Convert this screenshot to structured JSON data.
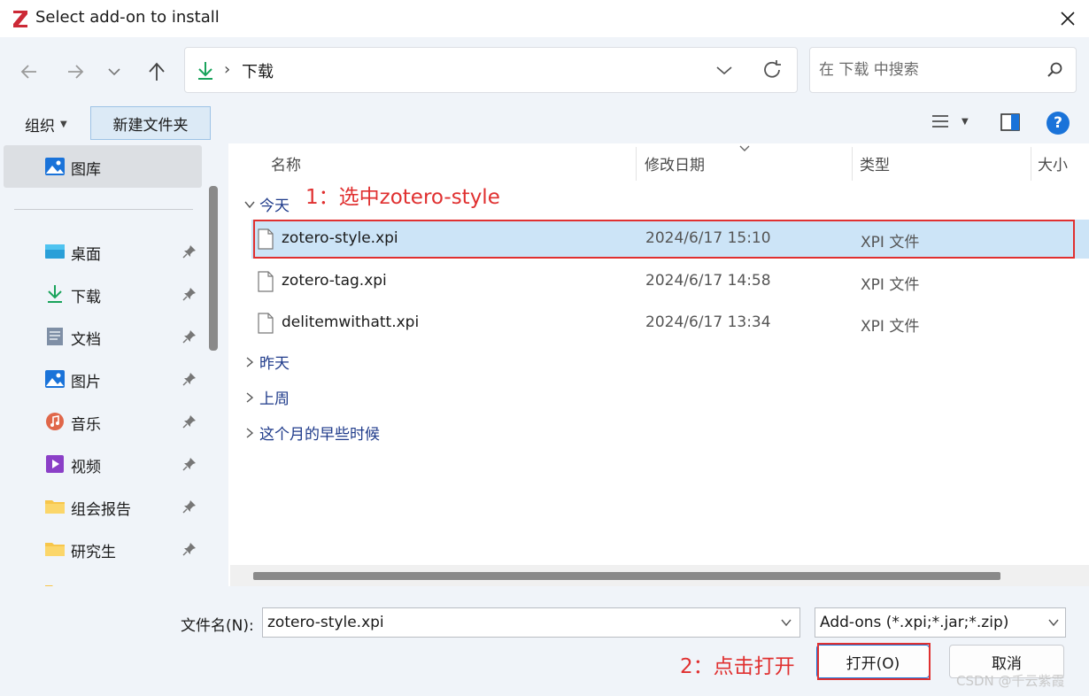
{
  "window": {
    "title": "Select add-on to install",
    "logo_letter": "Z"
  },
  "navigation": {
    "path": [
      "下载"
    ],
    "search_placeholder": "在 下载 中搜索"
  },
  "toolbar": {
    "organize_label": "组织",
    "new_folder_label": "新建文件夹",
    "help_label": "?"
  },
  "sidebar": {
    "items": [
      {
        "label": "图库",
        "icon": "gallery-icon"
      },
      {
        "label": "桌面",
        "icon": "desktop-icon"
      },
      {
        "label": "下载",
        "icon": "download-icon"
      },
      {
        "label": "文档",
        "icon": "document-icon"
      },
      {
        "label": "图片",
        "icon": "pictures-icon"
      },
      {
        "label": "音乐",
        "icon": "music-icon"
      },
      {
        "label": "视频",
        "icon": "video-icon"
      },
      {
        "label": "组会报告",
        "icon": "folder-icon"
      },
      {
        "label": "研究生",
        "icon": "folder-icon"
      }
    ]
  },
  "columns": {
    "name": "名称",
    "date": "修改日期",
    "type": "类型",
    "size": "大小"
  },
  "groups": {
    "today": "今天",
    "yesterday": "昨天",
    "last_week": "上周",
    "earlier_this_month": "这个月的早些时候"
  },
  "files": [
    {
      "name": "zotero-style.xpi",
      "date": "2024/6/17 15:10",
      "type": "XPI 文件",
      "selected": true
    },
    {
      "name": "zotero-tag.xpi",
      "date": "2024/6/17 14:58",
      "type": "XPI 文件",
      "selected": false
    },
    {
      "name": "delitemwithatt.xpi",
      "date": "2024/6/17 13:34",
      "type": "XPI 文件",
      "selected": false
    }
  ],
  "footer": {
    "filename_label": "文件名(N):",
    "filename_value": "zotero-style.xpi",
    "filter_value": "Add-ons (*.xpi;*.jar;*.zip)",
    "open_button": "打开(O)",
    "cancel_button": "取消"
  },
  "annotations": {
    "step1": "1：选中zotero-style",
    "step2": "2：点击打开",
    "color": "#e03030"
  },
  "watermark": "CSDN @千云紫霞",
  "colors": {
    "accent": "#1a73d9",
    "selection": "#cce4f7",
    "chrome": "#f0f4f9"
  }
}
